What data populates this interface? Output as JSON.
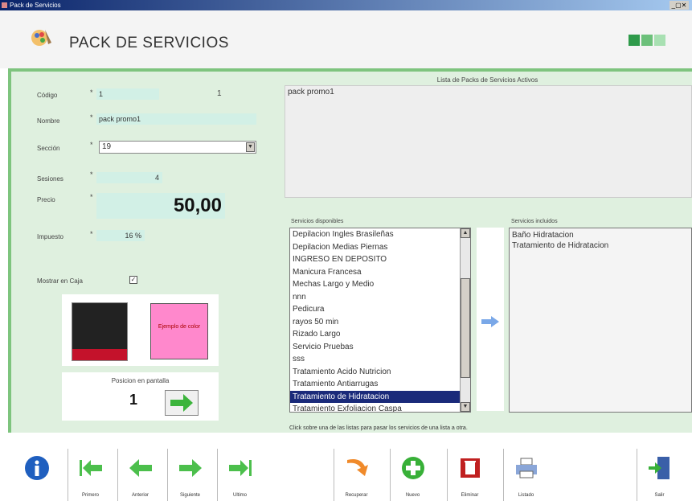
{
  "window": {
    "title": "Pack de Servicios"
  },
  "header": {
    "title": "PACK DE SERVICIOS",
    "status_colors": [
      "#2e9a4a",
      "#6cc07a",
      "#a8e0b2"
    ]
  },
  "form": {
    "codigo": {
      "label": "Código",
      "req": "*",
      "value": "1",
      "extra": "1"
    },
    "nombre": {
      "label": "Nombre",
      "req": "*",
      "value": "pack promo1"
    },
    "seccion": {
      "label": "Sección",
      "req": "*",
      "value": "19"
    },
    "sesiones": {
      "label": "Sesiones",
      "req": "*",
      "value": "4"
    },
    "precio": {
      "label": "Precio",
      "req": "*",
      "value": "50,00"
    },
    "impuesto": {
      "label": "Impuesto",
      "req": "*",
      "value": "16 %"
    },
    "mostrar_caja": {
      "label": "Mostrar en Caja",
      "checked": true
    },
    "color_example": "Ejemplo de color",
    "posicion": {
      "label": "Posicion en pantalla",
      "value": "1"
    }
  },
  "active_packs": {
    "title": "Lista de Packs de Servicios Activos",
    "items": [
      "pack promo1"
    ]
  },
  "available_services": {
    "title": "Servicios disponibles",
    "items": [
      "Depilacion Ingles Brasileñas",
      "Depilacion Medias Piernas",
      "INGRESO EN DEPOSITO",
      "Manicura Francesa",
      "Mechas Largo y Medio",
      "nnn",
      "Pedicura",
      "rayos 50 min",
      "Rizado Largo",
      "Servicio Pruebas",
      "sss",
      "Tratamiento Acido Nutricion",
      "Tratamiento Antiarrugas",
      "Tratamiento de Hidratacion",
      "Tratamiento Exfoliacion Caspa"
    ],
    "selected_index": 13
  },
  "included_services": {
    "title": "Servicios incluidos",
    "items": [
      "Baño Hidratacion",
      "Tratamiento de Hidratacion"
    ]
  },
  "hint": "Click sobre una de las listas para pasar los servicios de una lista a otra.",
  "toolbar": {
    "info": "",
    "primero": "Primero",
    "anterior": "Anterior",
    "siguiente": "Siguiente",
    "ultimo": "Ultimo",
    "recuperar": "Recuperar",
    "nuevo": "Nuevo",
    "eliminar": "Eliminar",
    "listado": "Listado",
    "salir": "Salir"
  }
}
